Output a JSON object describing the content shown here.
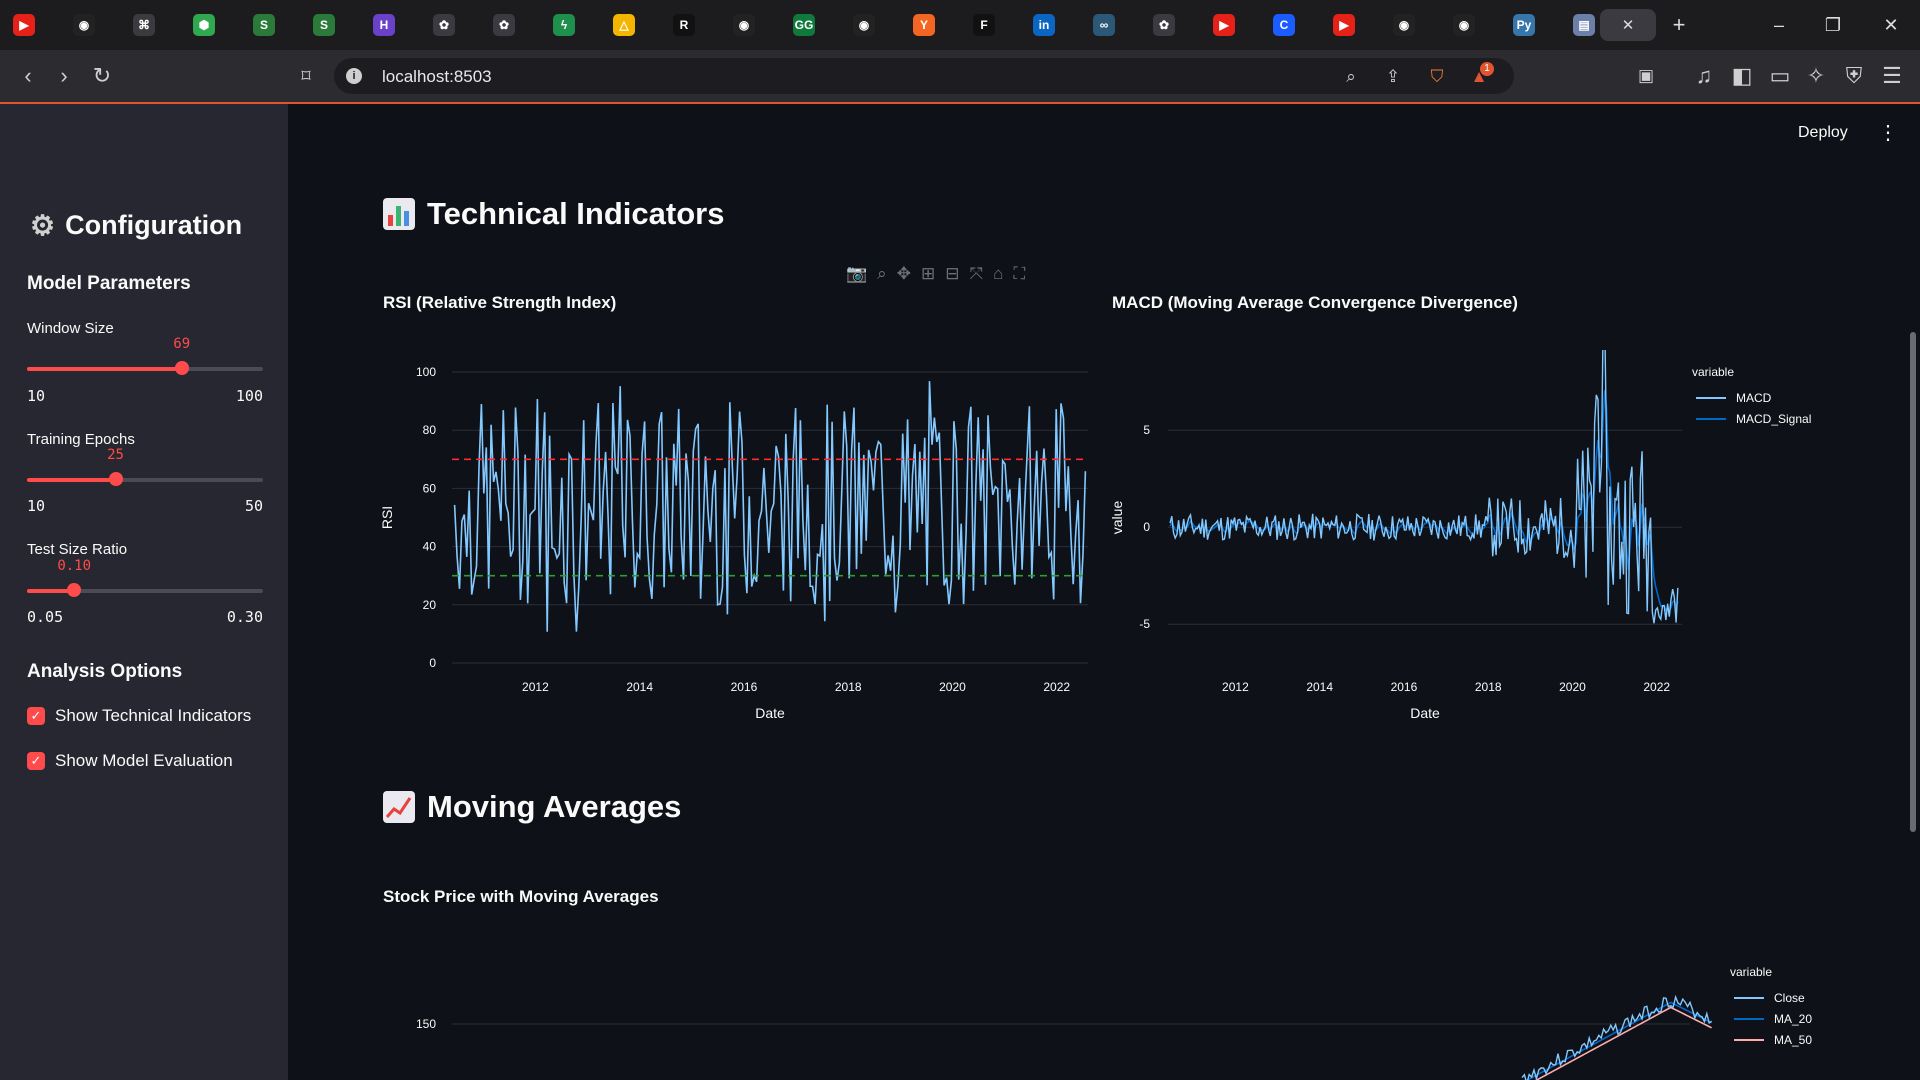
{
  "browser": {
    "tabs": [
      "youtube-icon",
      "github-icon",
      "command-icon",
      "shield-green-icon",
      "shipday-icon",
      "shipday-icon",
      "purple-h-icon",
      "chatgpt-icon",
      "chatgpt-icon",
      "bolt-icon",
      "drive-icon",
      "r-icon",
      "github-icon",
      "gg-icon",
      "github-icon",
      "ycombinator-icon",
      "framer-icon",
      "linkedin-icon",
      "link-icon",
      "chatgpt-icon",
      "youtube-icon",
      "c-icon",
      "youtube-icon",
      "github-icon",
      "github-icon",
      "python-icon",
      "chart-icon"
    ],
    "active_tab_close": "✕",
    "new_tab": "+",
    "url": "localhost:8503",
    "notification_count": "1"
  },
  "header": {
    "deploy_label": "Deploy"
  },
  "sidebar": {
    "title": "Configuration",
    "model_params_heading": "Model Parameters",
    "window_size": {
      "label": "Window Size",
      "value": "69",
      "min": "10",
      "max": "100",
      "fraction": 0.6556
    },
    "epochs": {
      "label": "Training Epochs",
      "value": "25",
      "min": "10",
      "max": "50",
      "fraction": 0.375
    },
    "test_ratio": {
      "label": "Test Size Ratio",
      "value": "0.10",
      "min": "0.05",
      "max": "0.30",
      "fraction": 0.2
    },
    "analysis_heading": "Analysis Options",
    "show_indicators": "Show Technical Indicators",
    "show_evaluation": "Show Model Evaluation"
  },
  "sections": {
    "technical": "Technical Indicators",
    "moving": "Moving Averages"
  },
  "colors": {
    "accent": "#ff4b4b",
    "rsi": "#83c9ff",
    "macd": "#83c9ff",
    "signal": "#0068c9",
    "ma50": "#ffabab",
    "overbought": "#ff2b2b",
    "oversold": "#2ca02c"
  },
  "chart_data": [
    {
      "type": "line",
      "title": "RSI (Relative Strength Index)",
      "xlabel": "Date",
      "ylabel": "RSI",
      "ylim": [
        0,
        100
      ],
      "yticks": [
        "0",
        "20",
        "40",
        "60",
        "80",
        "100"
      ],
      "xticks": [
        "2012",
        "2014",
        "2016",
        "2018",
        "2020",
        "2022"
      ],
      "xlim": [
        2010.4,
        2022.6
      ],
      "thresholds": [
        70,
        30
      ],
      "grid": true,
      "series": [
        {
          "values": [
            30,
            70,
            85,
            40,
            60,
            25,
            75,
            90,
            35,
            55,
            80,
            20,
            65,
            95,
            45,
            30,
            70,
            85,
            40,
            60,
            25,
            75,
            90,
            35,
            55,
            80,
            20,
            65,
            95,
            45,
            30,
            70,
            85,
            40,
            60,
            25,
            75,
            90,
            35,
            55,
            80,
            20,
            65,
            95,
            45
          ]
        }
      ]
    },
    {
      "type": "line",
      "title": "MACD (Moving Average Convergence Divergence)",
      "xlabel": "Date",
      "ylabel": "value",
      "yticks": [
        "-5",
        "0",
        "5"
      ],
      "ylim": [
        -7,
        8
      ],
      "xticks": [
        "2012",
        "2014",
        "2016",
        "2018",
        "2020",
        "2022"
      ],
      "xlim": [
        2010.4,
        2022.6
      ],
      "legend_title": "variable",
      "legend": "top-right",
      "series": [
        {
          "name": "MACD"
        },
        {
          "name": "MACD_Signal"
        }
      ]
    },
    {
      "type": "line",
      "title": "Stock Price with Moving Averages",
      "yticks": [
        "150"
      ],
      "legend_title": "variable",
      "legend": "top-right",
      "series": [
        {
          "name": "Close"
        },
        {
          "name": "MA_20"
        },
        {
          "name": "MA_50"
        }
      ]
    }
  ]
}
